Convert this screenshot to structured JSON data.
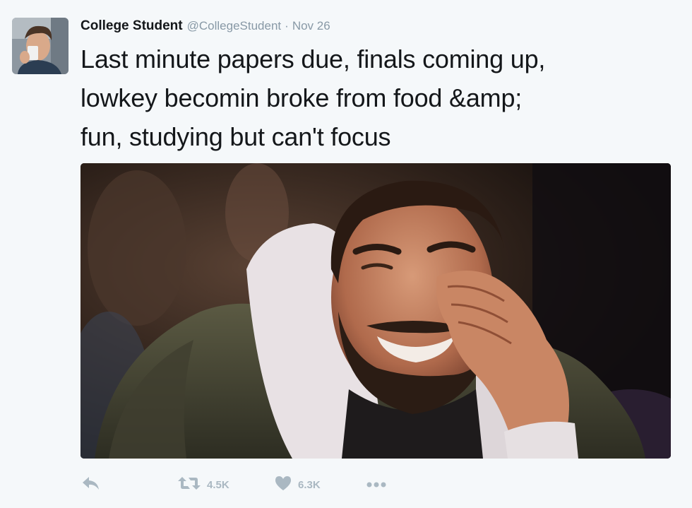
{
  "tweet": {
    "author_name": "College Student",
    "author_handle": "@CollegeStudent",
    "separator": "·",
    "date": "Nov 26",
    "text": "Last minute papers due, finals coming up,\nlowkey becomin broke from food &amp;\nfun, studying but can't focus",
    "retweet_count": "4.5K",
    "like_count": "6.3K"
  },
  "icons": {
    "reply": "reply-arrow-icon",
    "retweet": "retweet-icon",
    "like": "heart-icon",
    "more": "more-dots-icon"
  },
  "colors": {
    "background": "#f5f8fa",
    "text": "#14171a",
    "muted": "#8899a6",
    "action_icon": "#aab8c2"
  }
}
